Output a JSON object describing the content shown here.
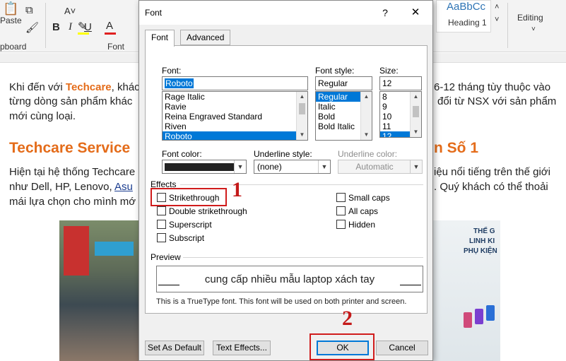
{
  "ribbon": {
    "paste_label": "Paste",
    "clipboard_label": "pboard",
    "font_group_label": "Font",
    "style_sample": "AaBbCc",
    "style_name": "Heading 1",
    "editing_label": "Editing"
  },
  "document": {
    "para1_line1_pre": "Khi đến với ",
    "para1_brand": "Techcare",
    "para1_line1_post": ", khác",
    "para1_line1_right": "6-12 tháng tùy thuộc vào",
    "para1_line2_left": "từng dòng sản phẩm khác",
    "para1_line2_right": "đổi từ NSX với sản phẩm",
    "para1_line3": "mới cùng loại.",
    "heading_left": "Techcare Service",
    "heading_right": "n Số 1",
    "para2_line1_left": "Hiện tại hệ thống Techcare",
    "para2_line1_right": "iệu nổi tiếng trên thế giới",
    "para2_line2_left": "như Dell, HP, Lenovo, ",
    "para2_line2_link": "Asu",
    "para2_line2_right": ". Quý khách có thể thoải",
    "para2_line3_left": "mái lựa chọn cho mình mớ",
    "photo_text_1": "THẾ G",
    "photo_text_2": "LINH KI",
    "photo_text_3": "PHỤ KIỆN"
  },
  "dialog": {
    "title": "Font",
    "help": "?",
    "close": "✕",
    "tabs": {
      "font": "Font",
      "advanced": "Advanced"
    },
    "font_label": "Font:",
    "font_value": "Roboto",
    "font_list": [
      "Rage Italic",
      "Ravie",
      "Reina Engraved Standard",
      "Riven",
      "Roboto"
    ],
    "style_label": "Font style:",
    "style_value": "Regular",
    "style_list": [
      "Regular",
      "Italic",
      "Bold",
      "Bold Italic"
    ],
    "size_label": "Size:",
    "size_value": "12",
    "size_list": [
      "8",
      "9",
      "10",
      "11",
      "12"
    ],
    "font_color_label": "Font color:",
    "underline_style_label": "Underline style:",
    "underline_style_value": "(none)",
    "underline_color_label": "Underline color:",
    "underline_color_value": "Automatic",
    "effects_label": "Effects",
    "effects_left": [
      "Strikethrough",
      "Double strikethrough",
      "Superscript",
      "Subscript"
    ],
    "effects_right": [
      "Small caps",
      "All caps",
      "Hidden"
    ],
    "preview_label": "Preview",
    "preview_text": "cung cấp nhiều mẫu laptop xách tay",
    "note": "This is a TrueType font. This font will be used on both printer and screen.",
    "buttons": {
      "set_default": "Set As Default",
      "text_effects": "Text Effects...",
      "ok": "OK",
      "cancel": "Cancel"
    }
  },
  "annotations": {
    "one": "1",
    "two": "2",
    "color": "#c41a1a"
  }
}
